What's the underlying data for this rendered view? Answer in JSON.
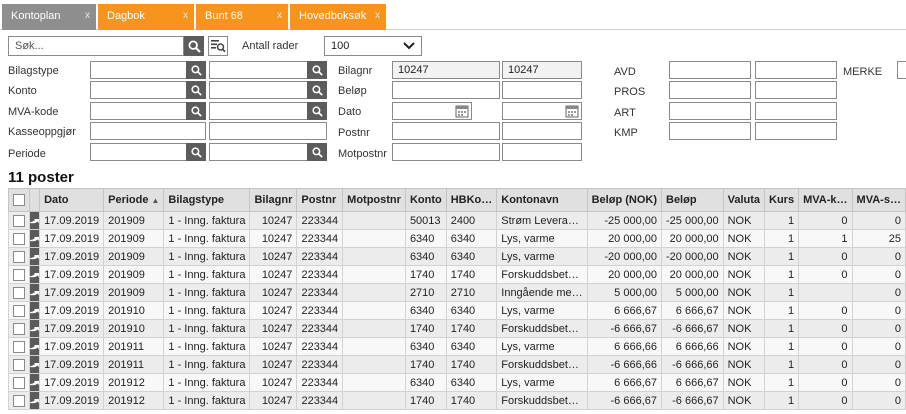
{
  "tabs": [
    {
      "label": "Kontoplan",
      "style": "gray"
    },
    {
      "label": "Dagbok",
      "style": "orange"
    },
    {
      "label": "Bunt 68",
      "style": "orange"
    },
    {
      "label": "Hovedboksøk",
      "style": "orange"
    }
  ],
  "tab_close_glyph": "x",
  "search": {
    "placeholder": "Søk...",
    "rows_label": "Antall rader",
    "rows_value": "100"
  },
  "filters": {
    "bilagstype": "Bilagstype",
    "konto": "Konto",
    "mva_kode": "MVA-kode",
    "kasseoppgjor": "Kasseoppgjør",
    "periode": "Periode",
    "bilagnr": "Bilagnr",
    "bilagnr_from": "10247",
    "bilagnr_to": "10247",
    "belop": "Beløp",
    "dato": "Dato",
    "postnr": "Postnr",
    "motpostnr": "Motpostnr",
    "avd": "AVD",
    "pros": "PROS",
    "art": "ART",
    "kmp": "KMP",
    "merke": "MERKE"
  },
  "result_title": "11 poster",
  "table": {
    "columns": [
      "",
      "",
      "Dato",
      "Periode",
      "Bilagstype",
      "Bilagnr",
      "Postnr",
      "Motpostnr",
      "Konto",
      "HBKo…",
      "Kontonavn",
      "Beløp (NOK)",
      "Beløp",
      "Valuta",
      "Kurs",
      "MVA-k…",
      "MVA-s…"
    ],
    "sorted_column": "Periode",
    "rows": [
      [
        "17.09.2019",
        "201909",
        "1 - Inng. faktura",
        "10247",
        "223344",
        "",
        "50013",
        "2400",
        "Strøm Levera…",
        "-25 000,00",
        "-25 000,00",
        "NOK",
        "1",
        "0",
        "0"
      ],
      [
        "17.09.2019",
        "201909",
        "1 - Inng. faktura",
        "10247",
        "223344",
        "",
        "6340",
        "6340",
        "Lys, varme",
        "20 000,00",
        "20 000,00",
        "NOK",
        "1",
        "1",
        "25"
      ],
      [
        "17.09.2019",
        "201909",
        "1 - Inng. faktura",
        "10247",
        "223344",
        "",
        "6340",
        "6340",
        "Lys, varme",
        "-20 000,00",
        "-20 000,00",
        "NOK",
        "1",
        "0",
        "0"
      ],
      [
        "17.09.2019",
        "201909",
        "1 - Inng. faktura",
        "10247",
        "223344",
        "",
        "1740",
        "1740",
        "Forskuddsbet…",
        "20 000,00",
        "20 000,00",
        "NOK",
        "1",
        "0",
        "0"
      ],
      [
        "17.09.2019",
        "201909",
        "1 - Inng. faktura",
        "10247",
        "223344",
        "",
        "2710",
        "2710",
        "Inngående me…",
        "5 000,00",
        "5 000,00",
        "NOK",
        "1",
        "",
        "0"
      ],
      [
        "17.09.2019",
        "201910",
        "1 - Inng. faktura",
        "10247",
        "223344",
        "",
        "6340",
        "6340",
        "Lys, varme",
        "6 666,67",
        "6 666,67",
        "NOK",
        "1",
        "0",
        "0"
      ],
      [
        "17.09.2019",
        "201910",
        "1 - Inng. faktura",
        "10247",
        "223344",
        "",
        "1740",
        "1740",
        "Forskuddsbet…",
        "-6 666,67",
        "-6 666,67",
        "NOK",
        "1",
        "0",
        "0"
      ],
      [
        "17.09.2019",
        "201911",
        "1 - Inng. faktura",
        "10247",
        "223344",
        "",
        "6340",
        "6340",
        "Lys, varme",
        "6 666,66",
        "6 666,66",
        "NOK",
        "1",
        "0",
        "0"
      ],
      [
        "17.09.2019",
        "201911",
        "1 - Inng. faktura",
        "10247",
        "223344",
        "",
        "1740",
        "1740",
        "Forskuddsbet…",
        "-6 666,66",
        "-6 666,66",
        "NOK",
        "1",
        "0",
        "0"
      ],
      [
        "17.09.2019",
        "201912",
        "1 - Inng. faktura",
        "10247",
        "223344",
        "",
        "6340",
        "6340",
        "Lys, varme",
        "6 666,67",
        "6 666,67",
        "NOK",
        "1",
        "0",
        "0"
      ],
      [
        "17.09.2019",
        "201912",
        "1 - Inng. faktura",
        "10247",
        "223344",
        "",
        "1740",
        "1740",
        "Forskuddsbet…",
        "-6 666,67",
        "-6 666,67",
        "NOK",
        "1",
        "0",
        "0"
      ]
    ]
  },
  "colors": {
    "tab_active": "#f7941d",
    "tab_inactive": "#8e8e8e",
    "icon_button": "#5c5c5c"
  }
}
